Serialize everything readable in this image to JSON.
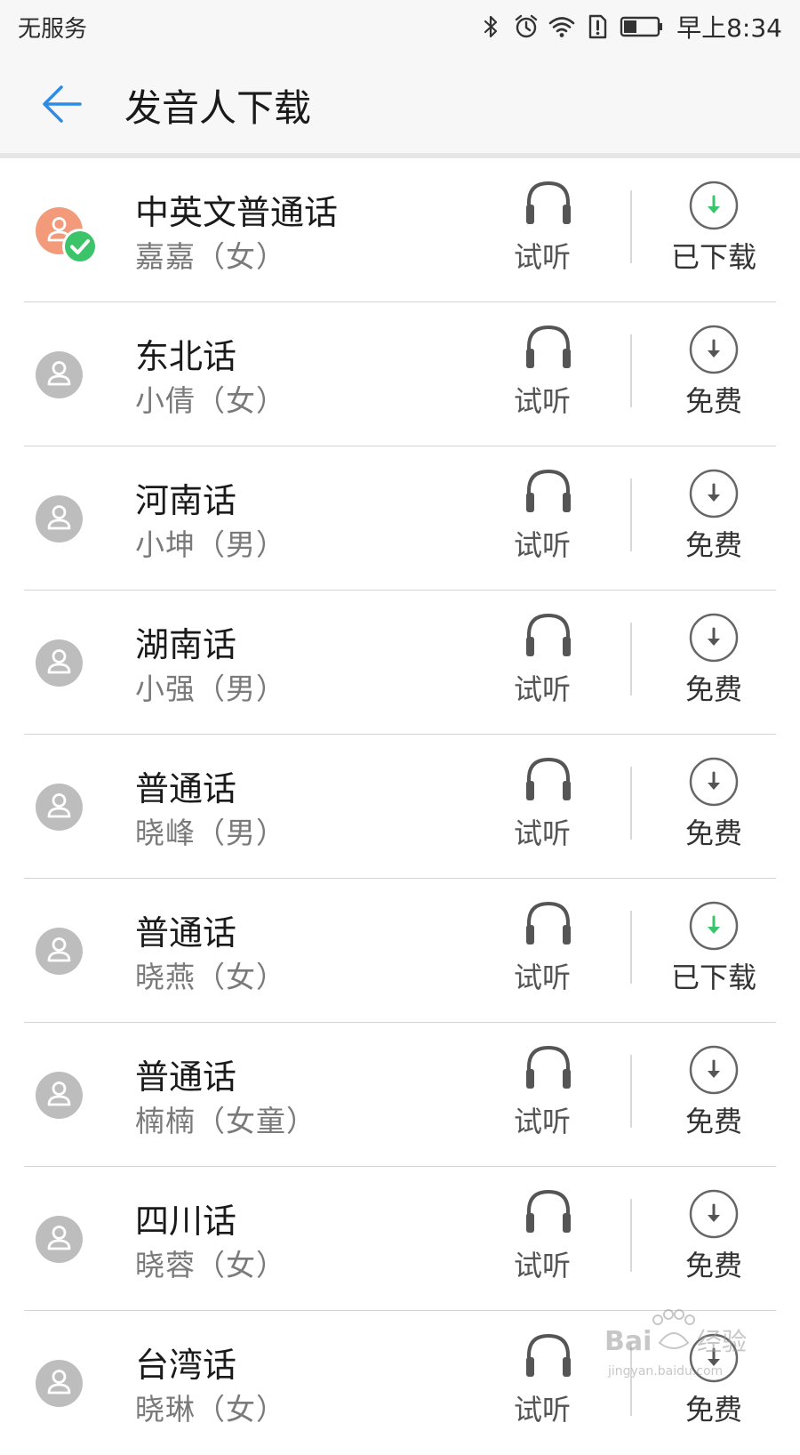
{
  "status_bar": {
    "carrier": "无服务",
    "time": "早上8:34",
    "icons": [
      "bluetooth-icon",
      "alarm-icon",
      "wifi-icon",
      "sim-alert-icon",
      "battery-icon"
    ]
  },
  "header": {
    "title": "发音人下载",
    "back_icon": "arrow-left-icon"
  },
  "colors": {
    "accent_blue": "#2f8ae6",
    "downloaded_green": "#3cc46a",
    "avatar_active": "#f39a7b",
    "avatar_inactive": "#bdbdbd"
  },
  "voices": [
    {
      "name": "中英文普通话",
      "speaker": "嘉嘉（女）",
      "listen_label": "试听",
      "download_label": "已下载",
      "downloaded": true,
      "active": true
    },
    {
      "name": "东北话",
      "speaker": "小倩（女）",
      "listen_label": "试听",
      "download_label": "免费",
      "downloaded": false,
      "active": false
    },
    {
      "name": "河南话",
      "speaker": "小坤（男）",
      "listen_label": "试听",
      "download_label": "免费",
      "downloaded": false,
      "active": false
    },
    {
      "name": "湖南话",
      "speaker": "小强（男）",
      "listen_label": "试听",
      "download_label": "免费",
      "downloaded": false,
      "active": false
    },
    {
      "name": "普通话",
      "speaker": "晓峰（男）",
      "listen_label": "试听",
      "download_label": "免费",
      "downloaded": false,
      "active": false
    },
    {
      "name": "普通话",
      "speaker": "晓燕（女）",
      "listen_label": "试听",
      "download_label": "已下载",
      "downloaded": true,
      "active": false
    },
    {
      "name": "普通话",
      "speaker": "楠楠（女童）",
      "listen_label": "试听",
      "download_label": "免费",
      "downloaded": false,
      "active": false
    },
    {
      "name": "四川话",
      "speaker": "晓蓉（女）",
      "listen_label": "试听",
      "download_label": "免费",
      "downloaded": false,
      "active": false
    },
    {
      "name": "台湾话",
      "speaker": "晓琳（女）",
      "listen_label": "试听",
      "download_label": "免费",
      "downloaded": false,
      "active": false
    }
  ],
  "watermark": {
    "text": "Bai 经验",
    "subtext": "jingyan.baidu.com"
  }
}
